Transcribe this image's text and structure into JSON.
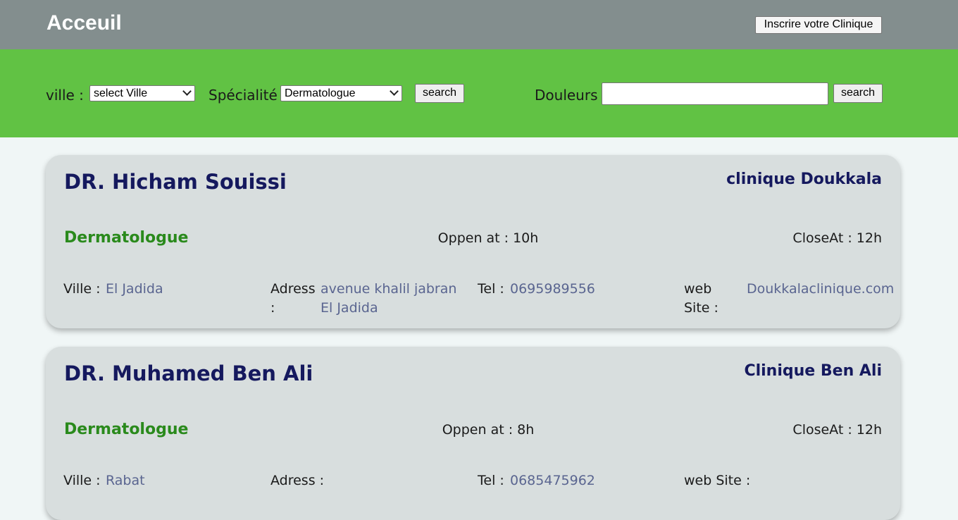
{
  "header": {
    "title": "Acceuil",
    "register_label": "Inscrire votre Clinique"
  },
  "search": {
    "ville_label": "ville :",
    "ville_selected": "select Ville",
    "specialite_label": "Spécialité",
    "specialite_selected": "Dermatologue",
    "search_label": "search",
    "douleurs_label": "Douleurs :",
    "douleurs_value": "",
    "search2_label": "search"
  },
  "fields": {
    "ville": "Ville :",
    "adress": "Adress :",
    "tel": "Tel :",
    "web": "web Site :"
  },
  "doctors": [
    {
      "name": "DR. Hicham Souissi",
      "clinic": "clinique Doukkala",
      "specialty": "Dermatologue",
      "open": "Oppen at : 10h",
      "close": "CloseAt : 12h",
      "ville": "El Jadida",
      "adress": "avenue khalil jabran El Jadida",
      "tel": "0695989556",
      "web": "Doukkalaclinique.com"
    },
    {
      "name": "DR. Muhamed Ben Ali",
      "clinic": "Clinique Ben Ali",
      "specialty": "Dermatologue",
      "open": "Oppen at : 8h",
      "close": "CloseAt : 12h",
      "ville": "Rabat",
      "adress": "",
      "tel": "0685475962",
      "web": ""
    }
  ],
  "colors": {
    "header_bg": "#838e8e",
    "search_bg": "#61c244",
    "card_bg": "#d8dede",
    "name_color": "#15195e",
    "specialty_color": "#2a8a1c",
    "value_color": "#5a6590"
  }
}
